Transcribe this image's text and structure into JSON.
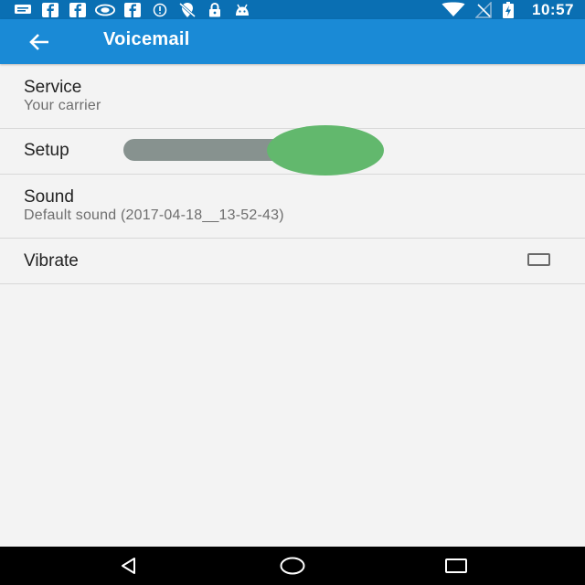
{
  "status_bar": {
    "time": "10:57",
    "left_icons": [
      "sms-icon",
      "facebook-icon",
      "facebook-icon",
      "nvidia-icon",
      "facebook-icon",
      "info-icon",
      "no-location-icon",
      "lock-icon",
      "android-icon"
    ],
    "right_icons": [
      "wifi-icon",
      "no-signal-icon",
      "battery-charging-icon"
    ]
  },
  "app_bar": {
    "title": "Voicemail",
    "color": "#1a8ad6"
  },
  "settings": {
    "service": {
      "label": "Service",
      "value": "Your carrier"
    },
    "setup": {
      "label": "Setup"
    },
    "sound": {
      "label": "Sound",
      "value": "Default sound (2017-04-18__13-52-43)"
    },
    "vibrate": {
      "label": "Vibrate",
      "checked": false
    }
  },
  "overlay": {
    "track_color": "#87928f",
    "knob_color": "#62b86d"
  },
  "nav_bar": {
    "buttons": [
      "back-icon",
      "home-icon",
      "recents-icon"
    ]
  }
}
